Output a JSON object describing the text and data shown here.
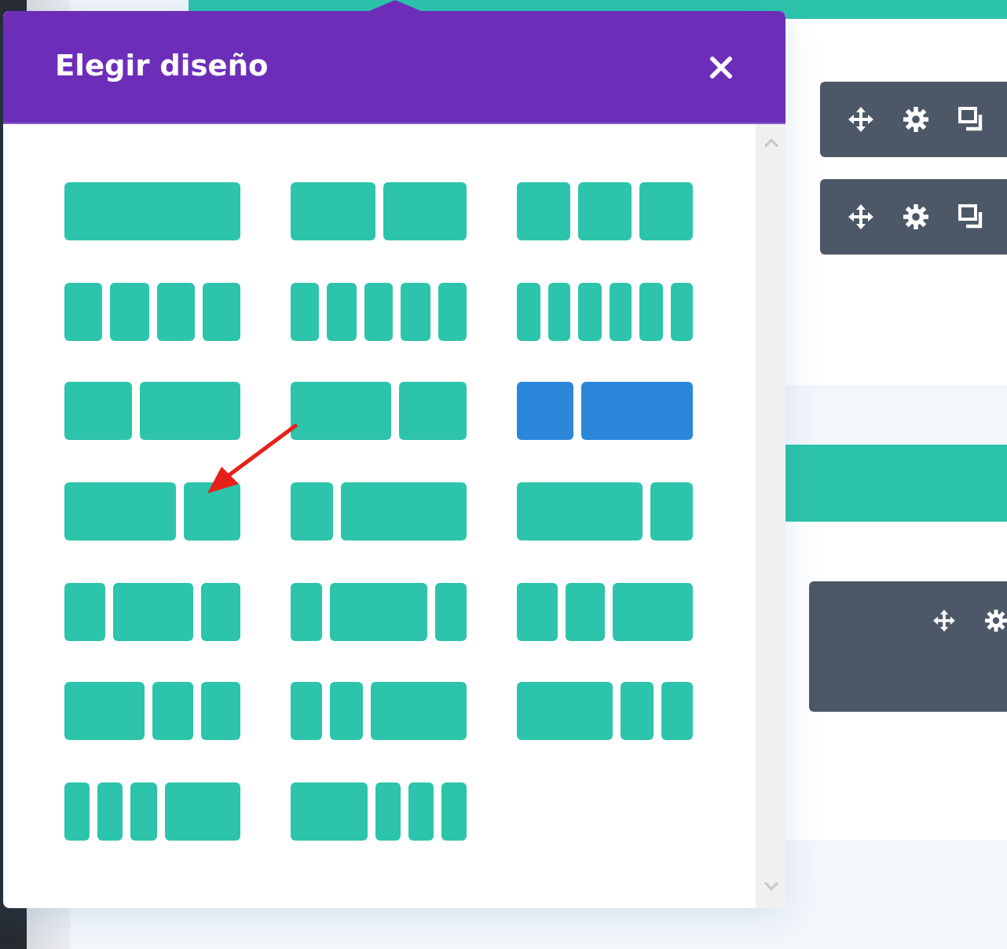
{
  "dialog": {
    "title": "Elegir diseño"
  },
  "layouts": [
    {
      "selected": false,
      "columns": [
        {
          "kind": "full"
        }
      ]
    },
    {
      "selected": false,
      "columns": [
        {
          "kind": "half"
        },
        {
          "kind": "half"
        }
      ]
    },
    {
      "selected": false,
      "columns": [
        {
          "kind": "third"
        },
        {
          "kind": "third"
        },
        {
          "kind": "third"
        }
      ]
    },
    {
      "selected": false,
      "columns": [
        {
          "kind": "quarter"
        },
        {
          "kind": "quarter"
        },
        {
          "kind": "quarter"
        },
        {
          "kind": "quarter"
        }
      ]
    },
    {
      "selected": false,
      "columns": [
        {
          "kind": "fifth"
        },
        {
          "kind": "fifth"
        },
        {
          "kind": "fifth"
        },
        {
          "kind": "fifth"
        },
        {
          "kind": "fifth"
        }
      ]
    },
    {
      "selected": false,
      "columns": [
        {
          "kind": "sixth"
        },
        {
          "kind": "sixth"
        },
        {
          "kind": "sixth"
        },
        {
          "kind": "sixth"
        },
        {
          "kind": "sixth"
        },
        {
          "kind": "sixth"
        }
      ]
    },
    {
      "selected": false,
      "columns": [
        {
          "kind": "twofifths"
        },
        {
          "kind": "threefifths"
        }
      ]
    },
    {
      "selected": false,
      "columns": [
        {
          "kind": "threefifths"
        },
        {
          "kind": "twofifths"
        }
      ]
    },
    {
      "selected": true,
      "columns": [
        {
          "kind": "third"
        },
        {
          "kind": "twothirds"
        }
      ]
    },
    {
      "selected": false,
      "columns": [
        {
          "kind": "twothirds"
        },
        {
          "kind": "third"
        }
      ]
    },
    {
      "selected": false,
      "columns": [
        {
          "kind": "quarter"
        },
        {
          "kind": "threequarters"
        }
      ]
    },
    {
      "selected": false,
      "columns": [
        {
          "kind": "threequarters"
        },
        {
          "kind": "quarter"
        }
      ]
    },
    {
      "selected": false,
      "columns": [
        {
          "kind": "quarter"
        },
        {
          "kind": "half"
        },
        {
          "kind": "quarter"
        }
      ]
    },
    {
      "selected": false,
      "columns": [
        {
          "kind": "fifth"
        },
        {
          "kind": "threefifths"
        },
        {
          "kind": "fifth"
        }
      ]
    },
    {
      "selected": false,
      "columns": [
        {
          "kind": "quarter"
        },
        {
          "kind": "quarter"
        },
        {
          "kind": "half"
        }
      ]
    },
    {
      "selected": false,
      "columns": [
        {
          "kind": "half"
        },
        {
          "kind": "quarter"
        },
        {
          "kind": "quarter"
        }
      ]
    },
    {
      "selected": false,
      "columns": [
        {
          "kind": "fifth"
        },
        {
          "kind": "fifth"
        },
        {
          "kind": "threefifths"
        }
      ]
    },
    {
      "selected": false,
      "columns": [
        {
          "kind": "threefifths"
        },
        {
          "kind": "fifth"
        },
        {
          "kind": "fifth"
        }
      ]
    },
    {
      "selected": false,
      "columns": [
        {
          "kind": "sixth"
        },
        {
          "kind": "sixth"
        },
        {
          "kind": "sixth"
        },
        {
          "kind": "half"
        }
      ]
    },
    {
      "selected": false,
      "columns": [
        {
          "kind": "half"
        },
        {
          "kind": "sixth"
        },
        {
          "kind": "sixth"
        },
        {
          "kind": "sixth"
        }
      ]
    }
  ]
}
